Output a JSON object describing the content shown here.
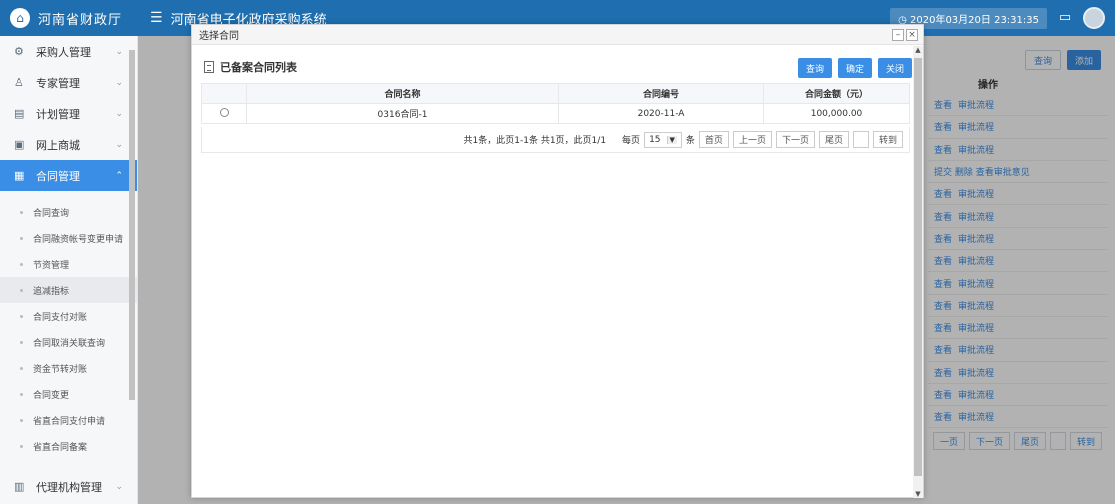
{
  "header": {
    "logo_text": "河南省财政厅",
    "system_title": "河南省电子化政府采购系统",
    "datetime": "2020年03月20日 23:31:35"
  },
  "sidebar": {
    "items": [
      {
        "label": "采购人管理",
        "icon": "gear-icon"
      },
      {
        "label": "专家管理",
        "icon": "person-icon"
      },
      {
        "label": "计划管理",
        "icon": "list-icon"
      },
      {
        "label": "网上商城",
        "icon": "store-icon"
      },
      {
        "label": "合同管理",
        "icon": "contract-icon"
      }
    ],
    "sub_items": [
      "合同查询",
      "合同融资帐号变更申请",
      "节资管理",
      "追减指标",
      "合同支付对账",
      "合同取消关联查询",
      "资金节转对账",
      "合同变更",
      "省直合同支付申请",
      "省直合同备案"
    ],
    "bottom_item": {
      "label": "代理机构管理",
      "icon": "agency-icon"
    }
  },
  "background": {
    "search_label": "查询",
    "add_label": "添加",
    "op_header": "操作",
    "op_view": "查看",
    "op_flow": "审批流程",
    "op_row4": "提交 删除 查看审批意见",
    "pager": [
      "一页",
      "下一页",
      "尾页",
      "转到"
    ]
  },
  "modal": {
    "title": "选择合同",
    "list_title": "已备案合同列表",
    "buttons": {
      "query": "查询",
      "confirm": "确定",
      "close": "关闭"
    },
    "columns": [
      "合同名称",
      "合同编号",
      "合同金额（元）"
    ],
    "rows": [
      {
        "name": "0316合同-1",
        "code": "2020-11-A",
        "amount": "100,000.00"
      }
    ],
    "pager": {
      "summary": "共1条，此页1-1条 共1页，此页1/1",
      "per_page_label": "每页",
      "per_page_value": "15",
      "unit": "条",
      "first": "首页",
      "prev": "上一页",
      "next": "下一页",
      "last": "尾页",
      "goto": "转到"
    }
  }
}
